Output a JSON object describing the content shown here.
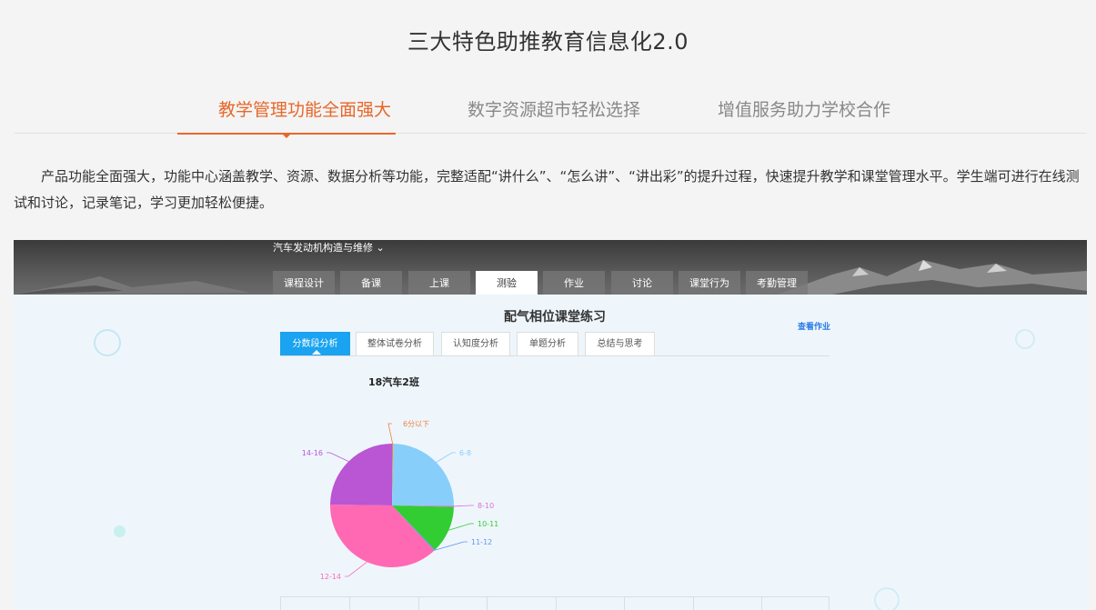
{
  "page": {
    "title": "三大特色助推教育信息化2.0"
  },
  "tabs": [
    {
      "label": "教学管理功能全面强大",
      "active": true
    },
    {
      "label": "数字资源超市轻松选择",
      "active": false
    },
    {
      "label": "增值服务助力学校合作",
      "active": false
    }
  ],
  "description": "产品功能全面强大，功能中心涵盖教学、资源、数据分析等功能，完整适配“讲什么”、“怎么讲”、“讲出彩”的提升过程，快速提升教学和课堂管理水平。学生端可进行在线测试和讨论，记录笔记，学习更加轻松便捷。",
  "screenshot": {
    "course_title": "汽车发动机构造与维修",
    "nav_tabs": [
      {
        "label": "课程设计",
        "active": false
      },
      {
        "label": "备课",
        "active": false
      },
      {
        "label": "上课",
        "active": false
      },
      {
        "label": "测验",
        "active": true
      },
      {
        "label": "作业",
        "active": false
      },
      {
        "label": "讨论",
        "active": false
      },
      {
        "label": "课堂行为",
        "active": false
      },
      {
        "label": "考勤管理",
        "active": false
      }
    ],
    "panel_title": "配气相位课堂练习",
    "view_homework": "查看作业",
    "sub_tabs": [
      {
        "label": "分数段分析",
        "active": true
      },
      {
        "label": "整体试卷分析",
        "active": false
      },
      {
        "label": "认知度分析",
        "active": false
      },
      {
        "label": "单题分析",
        "active": false
      },
      {
        "label": "总结与思考",
        "active": false
      }
    ],
    "class_title": "18汽车2班"
  },
  "chart_data": {
    "type": "pie",
    "title": "18汽车2班",
    "slices": [
      {
        "label": "6分以下",
        "value": 0.3,
        "color": "#f08040"
      },
      {
        "label": "6-8",
        "value": 25,
        "color": "#87cefa"
      },
      {
        "label": "8-10",
        "value": 0.3,
        "color": "#da70d6"
      },
      {
        "label": "10-11",
        "value": 12.5,
        "color": "#32cd32"
      },
      {
        "label": "11-12",
        "value": 0.3,
        "color": "#6495ed"
      },
      {
        "label": "12-14",
        "value": 37.5,
        "color": "#ff69b4"
      },
      {
        "label": "14-16",
        "value": 25,
        "color": "#ba55d3"
      }
    ],
    "colors": {
      "accent": "#e8672a",
      "subtab_active": "#1aa3f0"
    }
  }
}
